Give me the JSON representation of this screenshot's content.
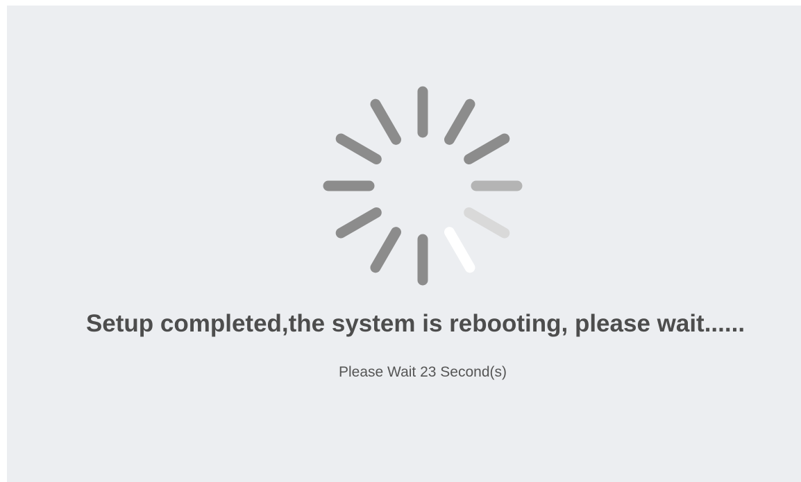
{
  "status": {
    "message": "Setup completed,the system is rebooting, please wait......",
    "countdown": "Please Wait 23 Second(s)"
  },
  "spinner": {
    "icon": "loading-spinner-icon",
    "spoke_color": "#8c8c8c",
    "highlight_color": "#ffffff"
  }
}
